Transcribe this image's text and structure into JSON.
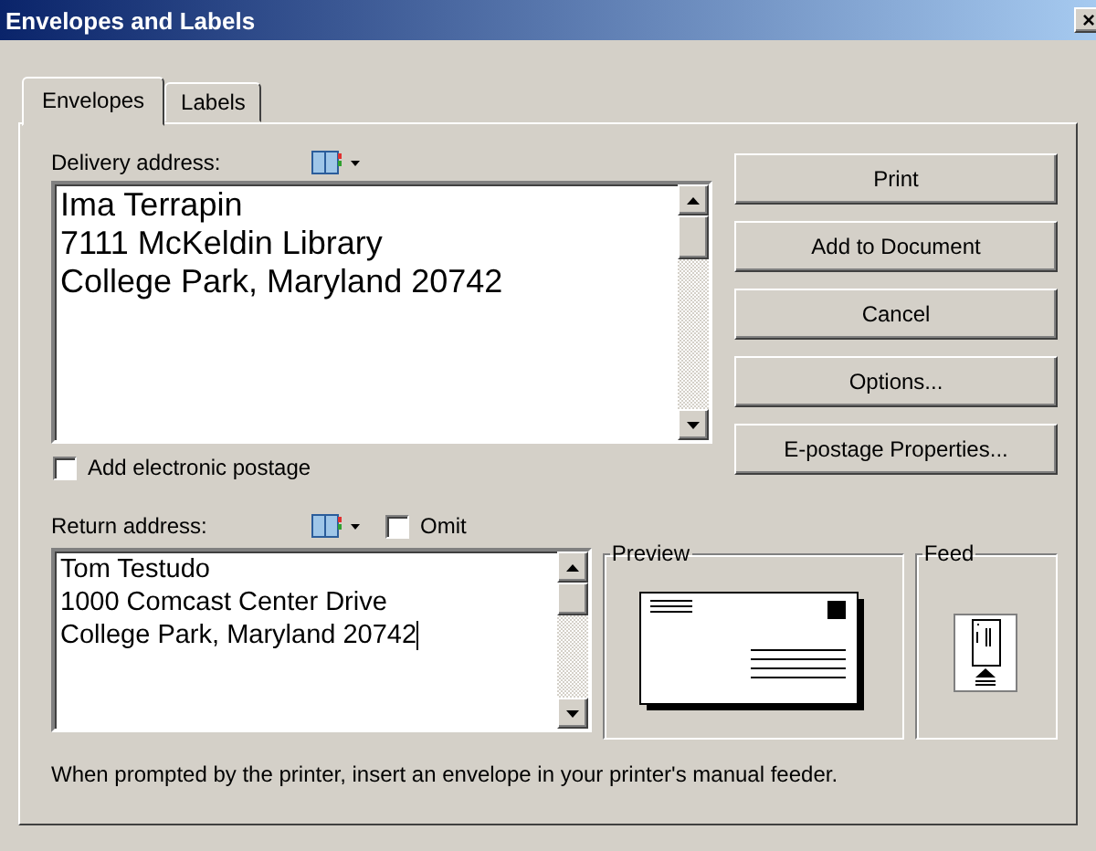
{
  "window": {
    "title": "Envelopes and Labels",
    "close": "×"
  },
  "tabs": [
    {
      "label": "Envelopes",
      "selected": true
    },
    {
      "label": "Labels",
      "selected": false
    }
  ],
  "delivery_address": {
    "label": "Delivery address:",
    "value": "Ima Terrapin\n7111 McKeldin Library\nCollege Park, Maryland 20742"
  },
  "electronic_postage": {
    "label": "Add electronic postage",
    "checked": false
  },
  "return_address": {
    "label": "Return address:",
    "value": "Tom Testudo\n1000 Comcast Center Drive\nCollege Park, Maryland 20742",
    "focused": true
  },
  "omit": {
    "label": "Omit",
    "checked": false
  },
  "buttons": [
    "Print",
    "Add to Document",
    "Cancel",
    "Options...",
    "E-postage Properties..."
  ],
  "preview": {
    "label": "Preview"
  },
  "feed": {
    "label": "Feed"
  },
  "status_text": "When prompted by the printer, insert an envelope in your printer's manual feeder."
}
